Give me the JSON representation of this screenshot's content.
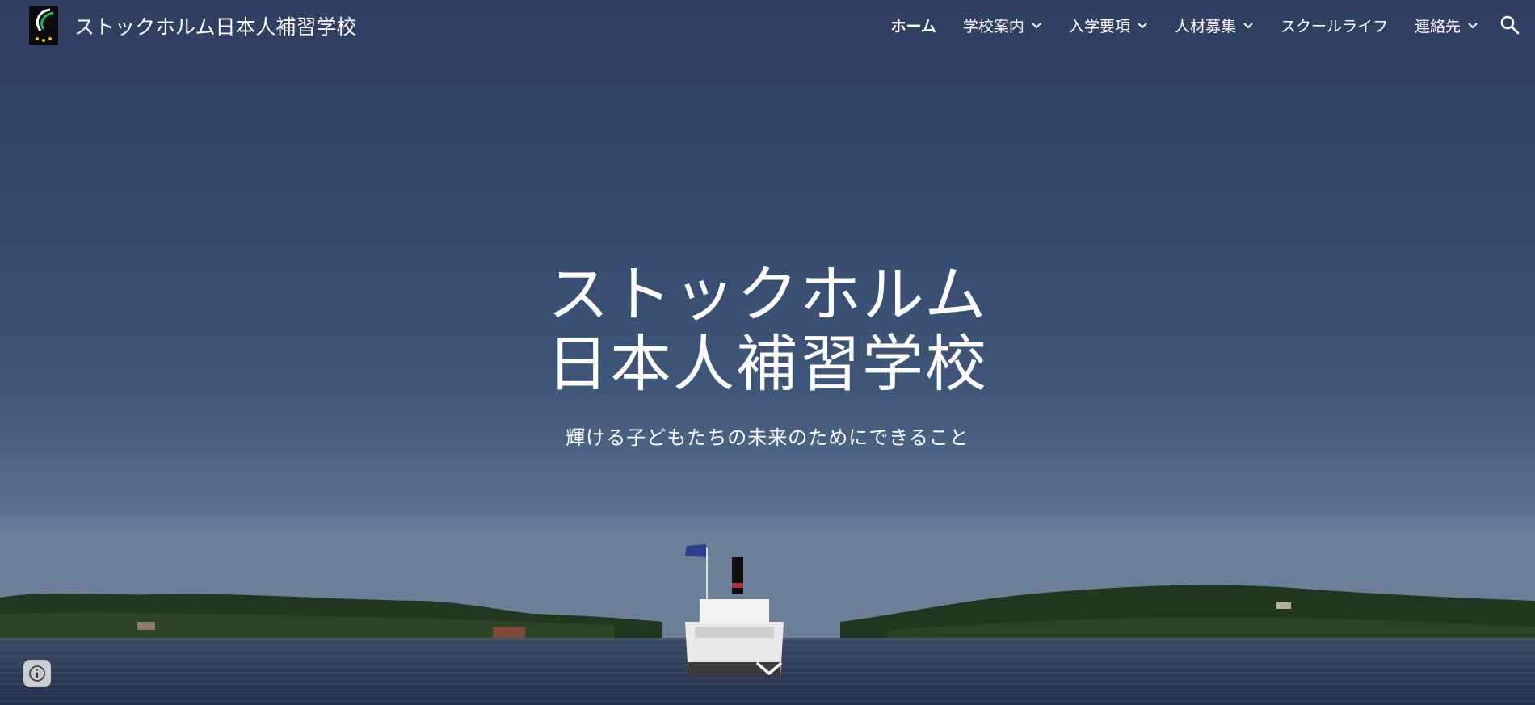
{
  "site": {
    "title": "ストックホルム日本人補習学校",
    "logo_icon": "school-logo"
  },
  "nav": {
    "items": [
      {
        "label": "ホーム",
        "dropdown": false,
        "active": true
      },
      {
        "label": "学校案内",
        "dropdown": true,
        "active": false
      },
      {
        "label": "入学要項",
        "dropdown": true,
        "active": false
      },
      {
        "label": "人材募集",
        "dropdown": true,
        "active": false
      },
      {
        "label": "スクールライフ",
        "dropdown": false,
        "active": false
      },
      {
        "label": "連絡先",
        "dropdown": true,
        "active": false
      }
    ],
    "search_icon": "search-icon"
  },
  "hero": {
    "title_line1": "ストックホルム",
    "title_line2": "日本人補習学校",
    "subtitle": "輝ける子どもたちの未来のためにできること",
    "background": "archipelago-steamboat-photo"
  },
  "colors": {
    "sky_top": "#2f3f61",
    "sky_bottom": "#6c7f99",
    "water": "#2c3c55",
    "text": "#ffffff"
  }
}
